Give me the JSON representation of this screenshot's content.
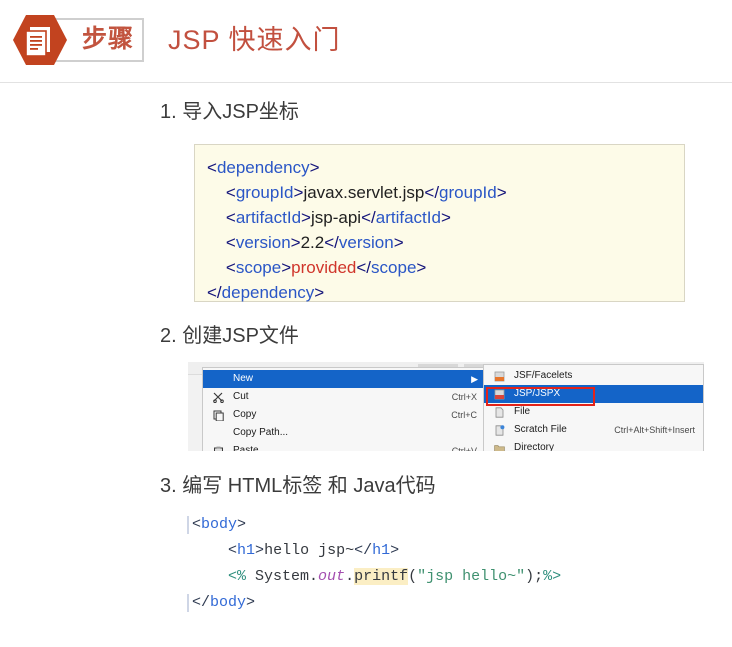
{
  "header": {
    "badge_icon": "document-stack-icon",
    "badge_label": "步骤",
    "title": "JSP 快速入门",
    "title_color": "#c2503f",
    "badge_color": "#c2431f"
  },
  "steps": [
    {
      "number": "1.",
      "text": "导入JSP坐标"
    },
    {
      "number": "2.",
      "text": "创建JSP文件"
    },
    {
      "number": "3.",
      "text": "编写 HTML标签 和 Java代码"
    }
  ],
  "xml_code": {
    "background": "#fdfbe8",
    "lines": [
      {
        "indent": 0,
        "parts": [
          {
            "t": "<",
            "c": "br"
          },
          {
            "t": "dependency",
            "c": "tag"
          },
          {
            "t": ">",
            "c": "br"
          }
        ]
      },
      {
        "indent": 1,
        "parts": [
          {
            "t": "<",
            "c": "br"
          },
          {
            "t": "groupId",
            "c": "tag"
          },
          {
            "t": ">",
            "c": "br"
          },
          {
            "t": "javax.servlet.jsp",
            "c": "txt"
          },
          {
            "t": "</",
            "c": "br"
          },
          {
            "t": "groupId",
            "c": "tag"
          },
          {
            "t": ">",
            "c": "br"
          }
        ]
      },
      {
        "indent": 1,
        "parts": [
          {
            "t": "<",
            "c": "br"
          },
          {
            "t": "artifactId",
            "c": "tag"
          },
          {
            "t": ">",
            "c": "br"
          },
          {
            "t": "jsp-api",
            "c": "txt"
          },
          {
            "t": "</",
            "c": "br"
          },
          {
            "t": "artifactId",
            "c": "tag"
          },
          {
            "t": ">",
            "c": "br"
          }
        ]
      },
      {
        "indent": 1,
        "parts": [
          {
            "t": "<",
            "c": "br"
          },
          {
            "t": "version",
            "c": "tag"
          },
          {
            "t": ">",
            "c": "br"
          },
          {
            "t": "2.2",
            "c": "txt"
          },
          {
            "t": "</",
            "c": "br"
          },
          {
            "t": "version",
            "c": "tag"
          },
          {
            "t": ">",
            "c": "br"
          }
        ]
      },
      {
        "indent": 1,
        "parts": [
          {
            "t": "<",
            "c": "br"
          },
          {
            "t": "scope",
            "c": "tag"
          },
          {
            "t": ">",
            "c": "br"
          },
          {
            "t": "provided",
            "c": "val-red"
          },
          {
            "t": "</",
            "c": "br"
          },
          {
            "t": "scope",
            "c": "tag"
          },
          {
            "t": ">",
            "c": "br"
          }
        ]
      },
      {
        "indent": 0,
        "parts": [
          {
            "t": "</",
            "c": "br"
          },
          {
            "t": "dependency",
            "c": "tag"
          },
          {
            "t": ">",
            "c": "br"
          }
        ]
      }
    ]
  },
  "ide_menu": {
    "left_items": [
      {
        "label": "New",
        "accel": "",
        "icon": "",
        "selected": true,
        "submenu_arrow": "▶"
      },
      {
        "label": "Cut",
        "accel": "Ctrl+X",
        "icon": "scissors-icon",
        "selected": false,
        "submenu_arrow": ""
      },
      {
        "label": "Copy",
        "accel": "Ctrl+C",
        "icon": "copy-icon",
        "selected": false,
        "submenu_arrow": ""
      },
      {
        "label": "Copy Path...",
        "accel": "",
        "icon": "",
        "selected": false,
        "submenu_arrow": ""
      },
      {
        "label": "Paste",
        "accel": "Ctrl+V",
        "icon": "paste-icon",
        "selected": false,
        "submenu_arrow": ""
      }
    ],
    "right_items": [
      {
        "label": "JSF/Facelets",
        "accel": "",
        "icon": "jsf-file-icon",
        "selected": false,
        "highlighted": false
      },
      {
        "label": "JSP/JSPX",
        "accel": "",
        "icon": "jsp-file-icon",
        "selected": true,
        "highlighted": true
      },
      {
        "label": "File",
        "accel": "",
        "icon": "file-icon",
        "selected": false,
        "highlighted": false
      },
      {
        "label": "Scratch File",
        "accel": "Ctrl+Alt+Shift+Insert",
        "icon": "scratch-file-icon",
        "selected": false,
        "highlighted": false
      },
      {
        "label": "Directory",
        "accel": "",
        "icon": "folder-icon",
        "selected": false,
        "highlighted": false
      }
    ],
    "highlight_color": "#1464c8",
    "annotation_color": "#e2231a"
  },
  "jsp_code": {
    "lines": [
      {
        "parts": [
          {
            "t": "<",
            "c": "br2"
          },
          {
            "t": "body",
            "c": "tag2"
          },
          {
            "t": ">",
            "c": "br2"
          }
        ]
      },
      {
        "parts": [
          {
            "t": "    ",
            "c": "plain"
          },
          {
            "t": "<",
            "c": "br2"
          },
          {
            "t": "h1",
            "c": "tag2"
          },
          {
            "t": ">",
            "c": "br2"
          },
          {
            "t": "hello jsp~",
            "c": "plain"
          },
          {
            "t": "</",
            "c": "br2"
          },
          {
            "t": "h1",
            "c": "tag2"
          },
          {
            "t": ">",
            "c": "br2"
          }
        ]
      },
      {
        "parts": [
          {
            "t": "    ",
            "c": "plain"
          },
          {
            "t": "<%",
            "c": "pct"
          },
          {
            "t": " System.",
            "c": "plain"
          },
          {
            "t": "out",
            "c": "field"
          },
          {
            "t": ".",
            "c": "plain"
          },
          {
            "t": "printf",
            "c": "method"
          },
          {
            "t": "(",
            "c": "plain"
          },
          {
            "t": "\"jsp hello~\"",
            "c": "str"
          },
          {
            "t": ");",
            "c": "plain"
          },
          {
            "t": "%>",
            "c": "pct"
          }
        ]
      },
      {
        "parts": [
          {
            "t": "</",
            "c": "br2"
          },
          {
            "t": "body",
            "c": "tag2"
          },
          {
            "t": ">",
            "c": "br2"
          }
        ]
      }
    ]
  }
}
